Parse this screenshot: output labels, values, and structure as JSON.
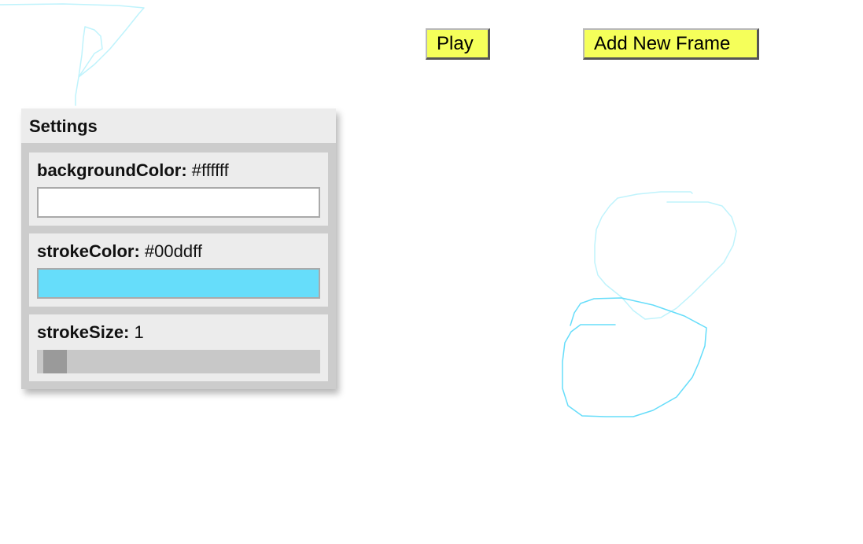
{
  "toolbar": {
    "play_label": "Play",
    "add_frame_label": "Add New Frame",
    "button_color": "#f5ff5a"
  },
  "settings": {
    "title": "Settings",
    "background_color": {
      "key": "backgroundColor:",
      "value": "#ffffff"
    },
    "stroke_color": {
      "key": "strokeColor:",
      "value": "#00ddff",
      "swatch": "#66ddfa"
    },
    "stroke_size": {
      "key": "strokeSize:",
      "value": "1"
    }
  },
  "canvas": {
    "background": "#ffffff",
    "stroke_color": "#00ddff",
    "onion_skin_color": "#bff3fc"
  }
}
